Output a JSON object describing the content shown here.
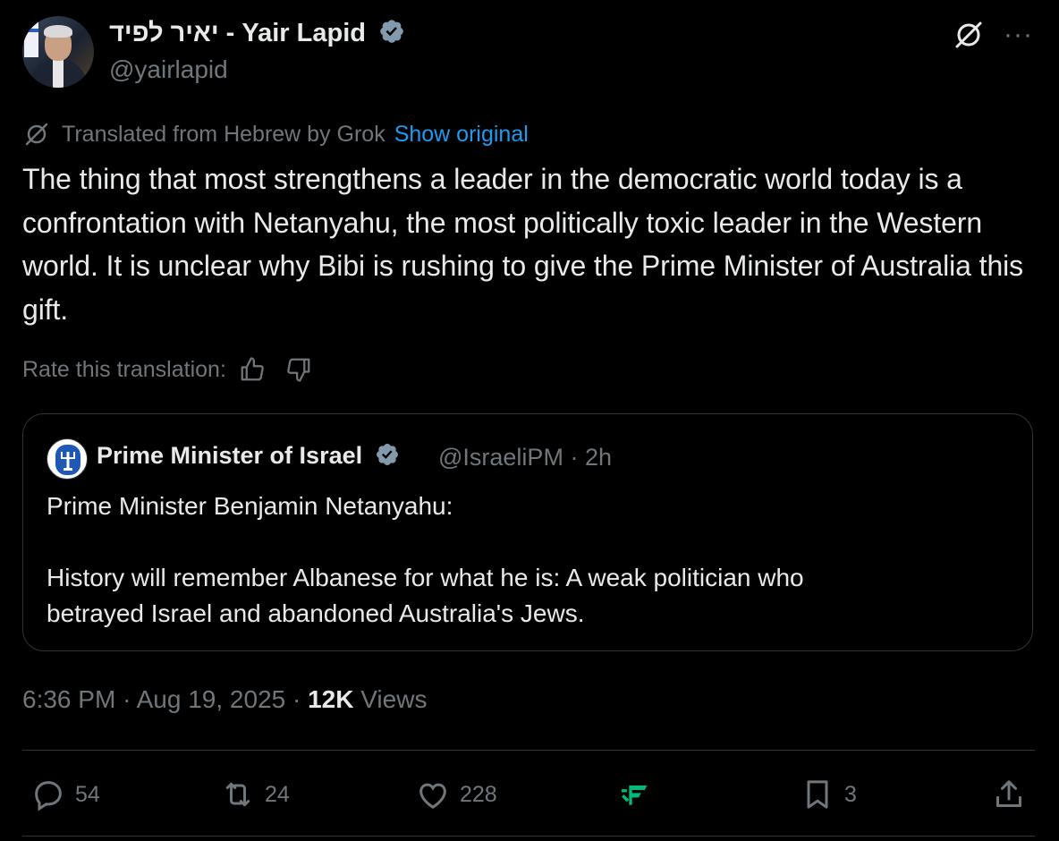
{
  "author": {
    "name": "יאיר לפיד - Yair Lapid",
    "handle": "@yairlapid"
  },
  "translation": {
    "label": "Translated from Hebrew by Grok",
    "show_original": "Show original",
    "rate_label": "Rate this translation:"
  },
  "tweet": {
    "text": "The thing that most strengthens a leader in the democratic world today is a confrontation with Netanyahu, the most politically toxic leader in the Western world. It is unclear why Bibi is rushing to give the Prime Minister of Australia this gift."
  },
  "quote": {
    "name": "Prime Minister of Israel",
    "handle": "@IsraeliPM",
    "time": "2h",
    "line1": "Prime Minister Benjamin Netanyahu:",
    "line2": "History will remember Albanese for what he is: A weak politician who betrayed Israel and abandoned Australia's Jews."
  },
  "meta": {
    "time": "6:36 PM",
    "date": "Aug 19, 2025",
    "views_count": "12K",
    "views_label": "Views"
  },
  "actions": {
    "replies": "54",
    "reposts": "24",
    "likes": "228",
    "bookmarks": "3"
  },
  "colors": {
    "background": "#000000",
    "text": "#e7e9ea",
    "muted": "#71767b",
    "link": "#1d9bf0",
    "verified": "#829aab",
    "border": "#2f3336",
    "grok_accent": "#00ba7c"
  },
  "icons": [
    "grok-icon",
    "more-icon",
    "verified-badge-icon",
    "thumbs-up-icon",
    "thumbs-down-icon",
    "reply-icon",
    "repost-icon",
    "like-icon",
    "grok-action-icon",
    "bookmark-icon",
    "share-icon"
  ]
}
